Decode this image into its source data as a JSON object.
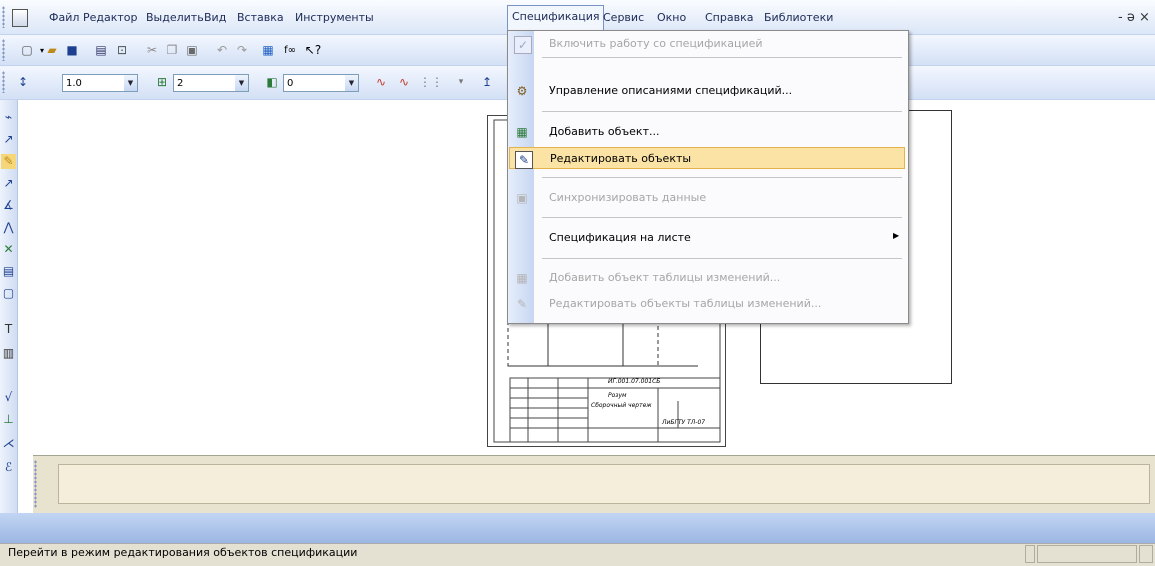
{
  "menubar": {
    "items": [
      "Файл",
      "Редактор",
      "Выделить",
      "Вид",
      "Вставка",
      "Инструменты",
      "Спецификация",
      "Сервис",
      "Окно",
      "Справка",
      "Библиотеки"
    ],
    "window_controls": "- ə ×"
  },
  "toolbar2": {
    "line_width": "1.0",
    "step": "2",
    "angle": "0"
  },
  "dropdown": {
    "items": [
      {
        "label": "Включить работу со спецификацией",
        "icon": "check-icon",
        "enabled": false
      },
      {
        "label": "Управление описаниями спецификаций...",
        "icon": "spec-manage-icon",
        "enabled": true
      },
      {
        "label": "Добавить объект...",
        "icon": "add-object-icon",
        "enabled": true
      },
      {
        "label": "Редактировать объекты",
        "icon": "edit-objects-icon",
        "enabled": true,
        "highlighted": true
      },
      {
        "label": "Синхронизировать данные",
        "icon": "sync-icon",
        "enabled": false
      },
      {
        "label": "Спецификация на листе",
        "icon": "none",
        "enabled": true,
        "submenu": true
      },
      {
        "label": "Добавить объект таблицы изменений...",
        "icon": "add-change-icon",
        "enabled": false
      },
      {
        "label": "Редактировать объекты таблицы изменений...",
        "icon": "edit-change-icon",
        "enabled": false
      }
    ],
    "submenu_arrow": "▶"
  },
  "drawing": {
    "stamp_code": "ИГ.001.07.001СБ",
    "stamp_title_1": "Розум",
    "stamp_title_2": "Сборочный чертеж",
    "stamp_org": "ЛиБГТУ ТЛ-07"
  },
  "status": {
    "text": "Перейти в режим редактирования объектов спецификации"
  },
  "colors": {
    "menu_highlight": "#fbe3a6",
    "menu_highlight_border": "#e5b34c",
    "toolbar_blue": "#d3e0f5",
    "command_panel": "#e8e3cf"
  }
}
